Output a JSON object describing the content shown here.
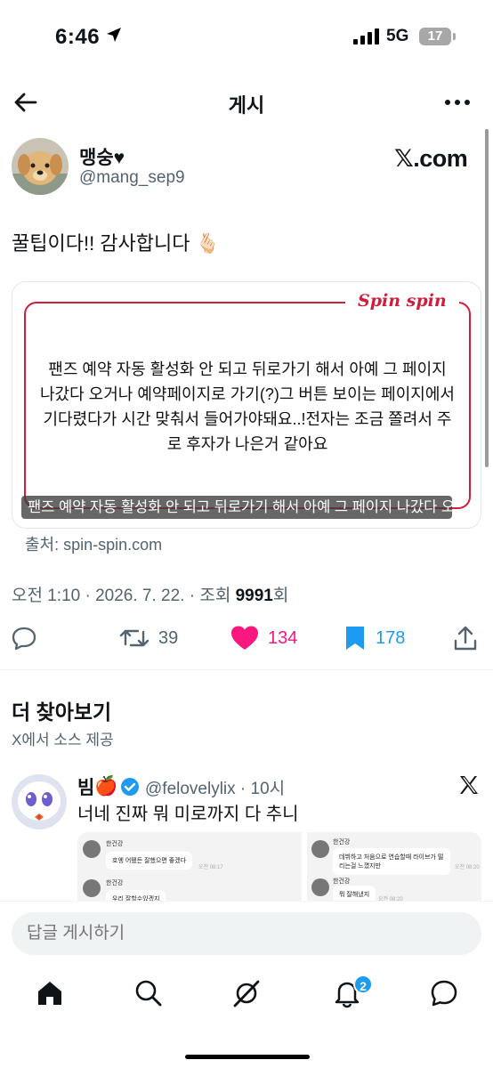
{
  "status": {
    "time": "6:46",
    "network": "5G",
    "battery": "17"
  },
  "nav": {
    "title": "게시"
  },
  "author": {
    "name": "맹숭♥",
    "handle": "@mang_sep9",
    "site": "𝕏.com"
  },
  "tweet": {
    "text": "꿀팁이다!! 감사합니다 🫰🏻"
  },
  "card": {
    "logo": "Spin spin",
    "body": "팬즈 예약 자동 활성화 안 되고 뒤로가기 해서 아예 그 페이지 나갔다 오거나 예약페이지로 가기(?)그 버튼 보이는 페이지에서 기다렸다가 시간 맞춰서 들어가야돼요..!전자는 조금 쫄려서 주로 후자가 나은거 같아요",
    "caption": "팬즈 예약 자동 활성화 안 되고 뒤로가기 해서 아예 그 페이지 나갔다 오...",
    "source": "출처: spin-spin.com"
  },
  "meta": {
    "datetime": "오전 1:10 · 2026. 7. 22. · 조회 ",
    "views": "9991",
    "views_suffix": "회"
  },
  "actions": {
    "retweets": "39",
    "likes": "134",
    "bookmarks": "178"
  },
  "colors": {
    "like": "#f91880",
    "bookmark": "#1d9bf0",
    "accent": "#1d9bf0",
    "card_red": "#cf1f3a"
  },
  "explore": {
    "title": "더 찾아보기",
    "subtitle": "X에서 소스 제공"
  },
  "recommended": {
    "name": "빔",
    "name_emoji": "🍎",
    "handle": "@felovelylix · 10시",
    "text": "너네 진짜 뭐 미로까지 다 추니",
    "image1": {
      "messages": [
        {
          "sender": "한건강",
          "text": "호엥 어뗐든 잘했으면 좋겠다",
          "time": "오전 08:17"
        },
        {
          "sender": "한건강",
          "text": "우리 잘할수있겠지"
        }
      ]
    },
    "image2": {
      "messages": [
        {
          "sender": "한건강",
          "text": "데뷔하고 처음으로 연습할때 라이브가 떨리는걸 느꼈지만",
          "time": "오전 08:20"
        },
        {
          "sender": "한건강",
          "text": "뭐 잘해냈지",
          "time": "오전 08:20"
        }
      ]
    }
  },
  "reply": {
    "placeholder": "답글 게시하기"
  },
  "tabs": {
    "notifications_badge": "2"
  }
}
